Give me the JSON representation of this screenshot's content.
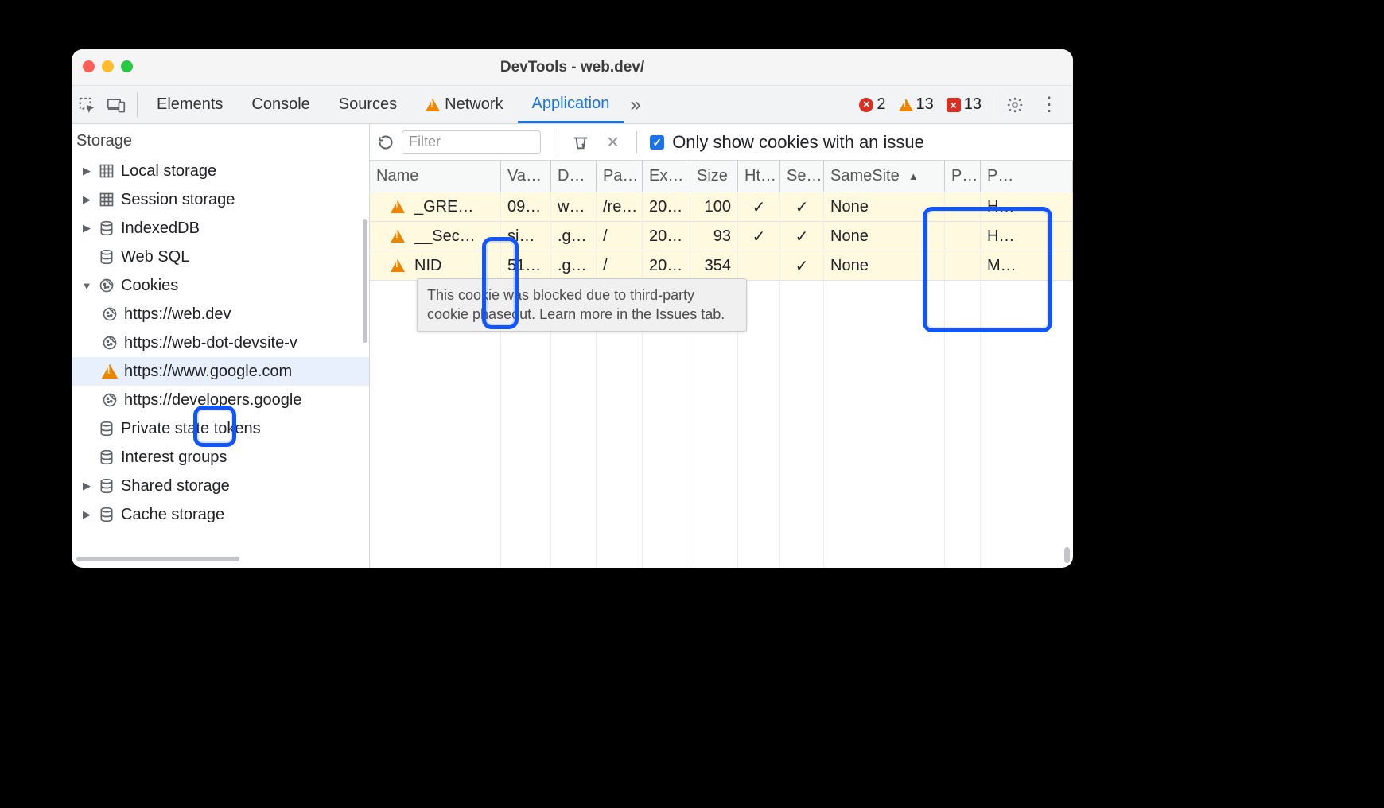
{
  "window": {
    "title": "DevTools - web.dev/"
  },
  "tabs": {
    "items": [
      "Elements",
      "Console",
      "Sources",
      "Network",
      "Application"
    ],
    "active": "Application",
    "network_warning": true
  },
  "counters": {
    "errors": "2",
    "warnings": "13",
    "messages": "13"
  },
  "sidebar": {
    "section": "Storage",
    "items": [
      {
        "icon": "grid",
        "label": "Local storage",
        "caret": "▶",
        "level": 1
      },
      {
        "icon": "grid",
        "label": "Session storage",
        "caret": "▶",
        "level": 1
      },
      {
        "icon": "db",
        "label": "IndexedDB",
        "caret": "▶",
        "level": 1
      },
      {
        "icon": "db",
        "label": "Web SQL",
        "caret": "",
        "level": 1,
        "nocaret": true
      },
      {
        "icon": "cookie",
        "label": "Cookies",
        "caret": "▼",
        "level": 1
      },
      {
        "icon": "cookie",
        "label": "https://web.dev",
        "caret": "",
        "level": 2
      },
      {
        "icon": "cookie",
        "label": "https://web-dot-devsite-v",
        "caret": "",
        "level": 2
      },
      {
        "icon": "warn",
        "label": "https://www.google.com",
        "caret": "",
        "level": 2,
        "selected": true
      },
      {
        "icon": "cookie",
        "label": "https://developers.google",
        "caret": "",
        "level": 2
      },
      {
        "icon": "db",
        "label": "Private state tokens",
        "caret": "",
        "level": 1,
        "nocaret": true
      },
      {
        "icon": "db",
        "label": "Interest groups",
        "caret": "",
        "level": 1,
        "nocaret": true
      },
      {
        "icon": "db",
        "label": "Shared storage",
        "caret": "▶",
        "level": 1
      },
      {
        "icon": "db",
        "label": "Cache storage",
        "caret": "▶",
        "level": 1
      }
    ]
  },
  "toolbar": {
    "filter_placeholder": "Filter",
    "only_issues_label": "Only show cookies with an issue",
    "only_issues_checked": true
  },
  "table": {
    "columns": [
      "Name",
      "Va…",
      "D…",
      "Pa…",
      "Ex…",
      "Size",
      "Ht…",
      "Se…",
      "SameSite",
      "P…",
      "P…"
    ],
    "sort_col": "SameSite",
    "sort_dir": "asc",
    "rows": [
      {
        "warn": true,
        "name": "_GRE…",
        "va": "09…",
        "do": "w…",
        "pa": "/re…",
        "ex": "20…",
        "sz": "100",
        "ht": "✓",
        "se": "✓",
        "ss": "None",
        "pk": "",
        "pr": "H…"
      },
      {
        "warn": true,
        "name": "__Sec…",
        "va": "si…",
        "do": ".g…",
        "pa": "/",
        "ex": "20…",
        "sz": "93",
        "ht": "✓",
        "se": "✓",
        "ss": "None",
        "pk": "",
        "pr": "H…"
      },
      {
        "warn": true,
        "name": "NID",
        "va": "51…",
        "do": ".g…",
        "pa": "/",
        "ex": "20…",
        "sz": "354",
        "ht": "",
        "se": "✓",
        "ss": "None",
        "pk": "",
        "pr": "M…"
      }
    ]
  },
  "tooltip": "This cookie was blocked due to third-party cookie phaseout. Learn more in the Issues tab."
}
